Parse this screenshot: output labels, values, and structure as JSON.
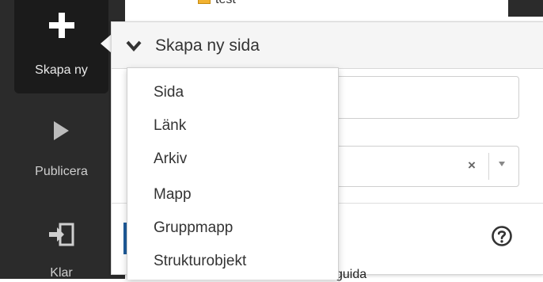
{
  "sidebar": {
    "create_label": "Skapa ny",
    "publish_label": "Publicera",
    "done_label": "Klar"
  },
  "tree": {
    "node_label": "test"
  },
  "panel": {
    "header_title": "Skapa ny sida",
    "select_clear": "×"
  },
  "menu": {
    "items": [
      {
        "label": "Sida"
      },
      {
        "label": "Länk"
      },
      {
        "label": "Arkiv"
      },
      {
        "label": "Mapp"
      },
      {
        "label": "Gruppmapp"
      },
      {
        "label": "Strukturobjekt"
      }
    ]
  },
  "background": {
    "partial_text": "guida"
  },
  "colors": {
    "sidebar": "#2b2b2b",
    "sidebar_active": "#1b1b1b",
    "accent": "#1e5c9b"
  }
}
